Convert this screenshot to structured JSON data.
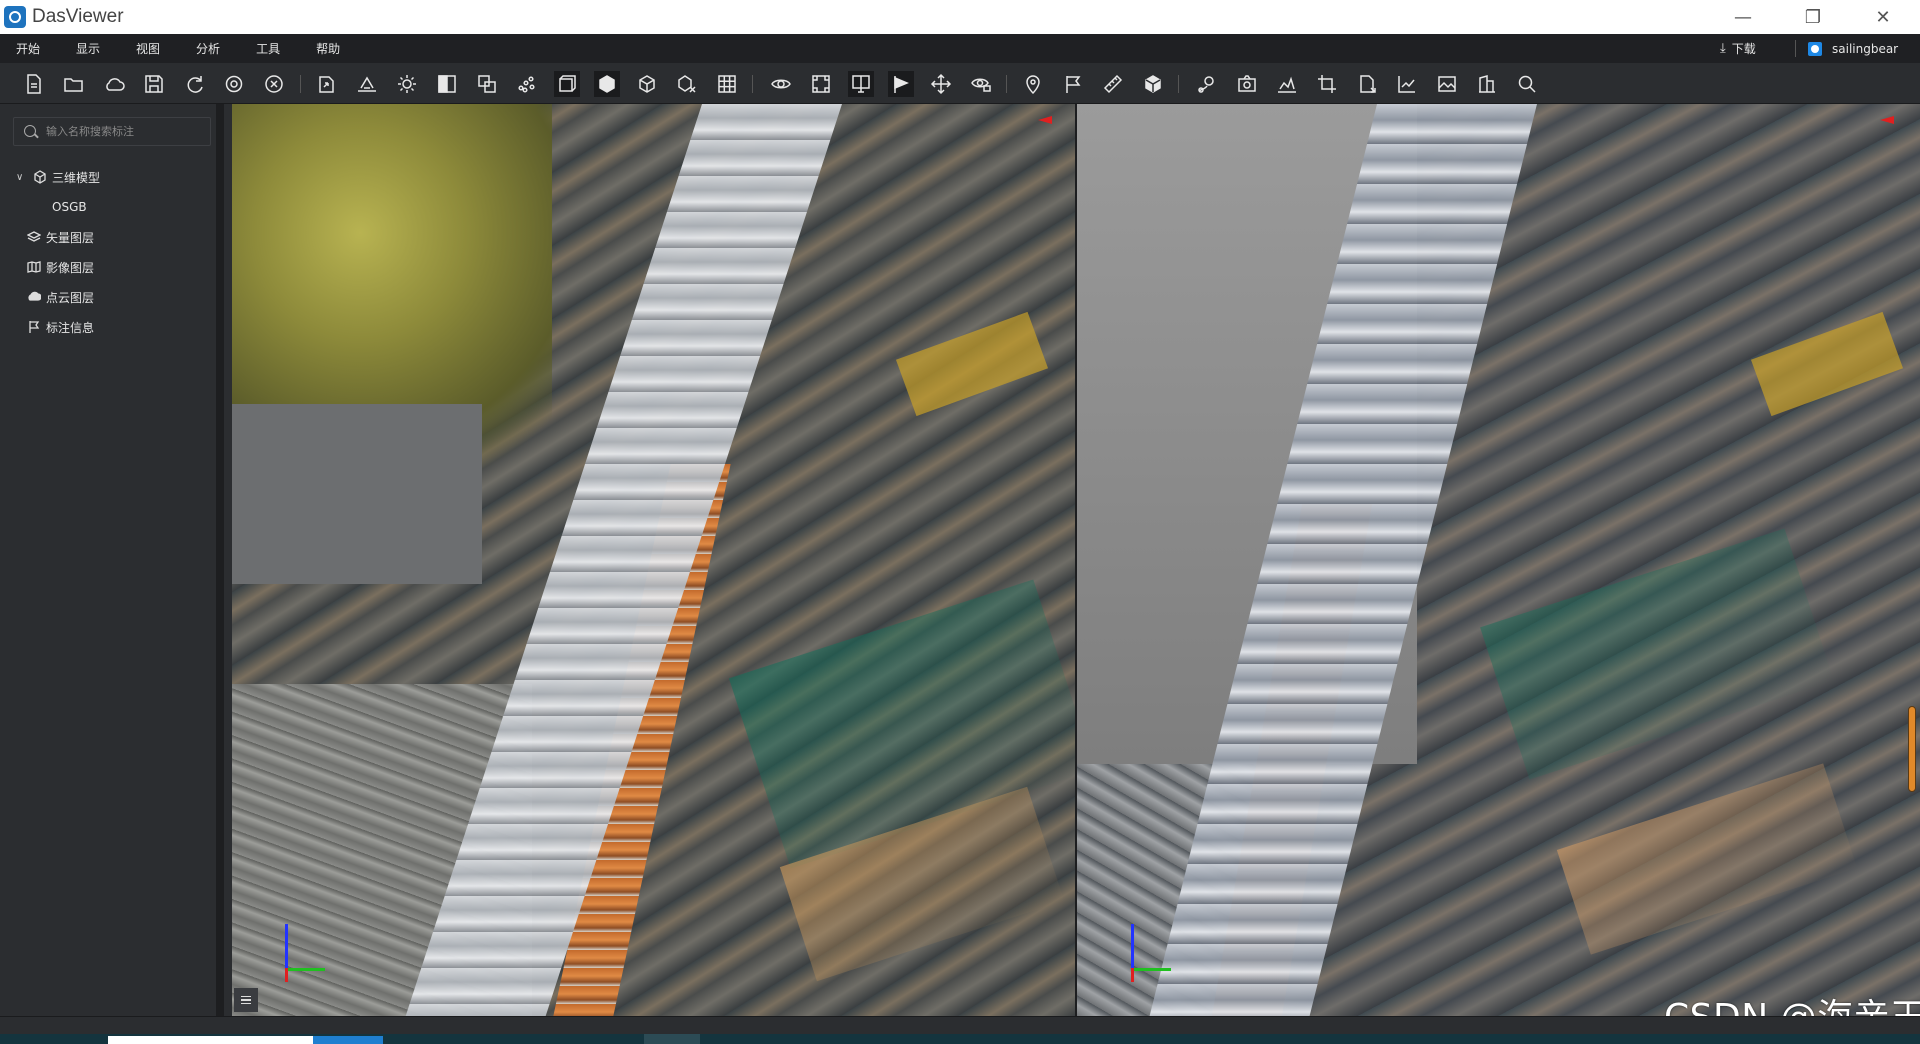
{
  "app": {
    "title": "DasViewer"
  },
  "menubar": {
    "items": [
      "开始",
      "显示",
      "视图",
      "分析",
      "工具",
      "帮助"
    ],
    "download_label": "下载",
    "user_name": "sailingbear"
  },
  "toolbar": {
    "icons": [
      "new-file-icon",
      "open-folder-icon",
      "cloud-icon",
      "save-icon",
      "refresh-icon",
      "settings-icon",
      "close-circle-icon",
      "export-icon",
      "terrain-icon",
      "sun-icon",
      "shading-icon",
      "layers-icon",
      "point-cloud-icon",
      "box-view-icon",
      "solid-cube-icon",
      "wire-cube-icon",
      "cube-remove-icon",
      "grid-icon",
      "eye-orbit-icon",
      "frame-icon",
      "split-view-icon",
      "flag-play-icon",
      "move-icon",
      "eye-lock-icon",
      "location-pin-icon",
      "annotation-flag-icon",
      "ruler-icon",
      "volume-cube-icon",
      "route-pin-icon",
      "camera-icon",
      "profile-icon",
      "crop-icon",
      "doc-export-icon",
      "chart-export-icon",
      "image-icon",
      "building-icon",
      "search-icon"
    ]
  },
  "sidebar": {
    "search_placeholder": "输入名称搜索标注",
    "tree": [
      {
        "label": "三维模型",
        "icon": "cube-icon",
        "expanded": true,
        "children": [
          "OSGB"
        ]
      },
      {
        "label": "矢量图层",
        "icon": "vector-layer-icon"
      },
      {
        "label": "影像图层",
        "icon": "image-layer-icon"
      },
      {
        "label": "点云图层",
        "icon": "point-cloud-layer-icon"
      },
      {
        "label": "标注信息",
        "icon": "annotation-icon"
      }
    ]
  },
  "watermark": "CSDN @海亲王",
  "colors": {
    "accent": "#1e73be",
    "background": "#2b2d30",
    "menubar": "#1f2023",
    "scroll_handle": "#e0892a"
  }
}
